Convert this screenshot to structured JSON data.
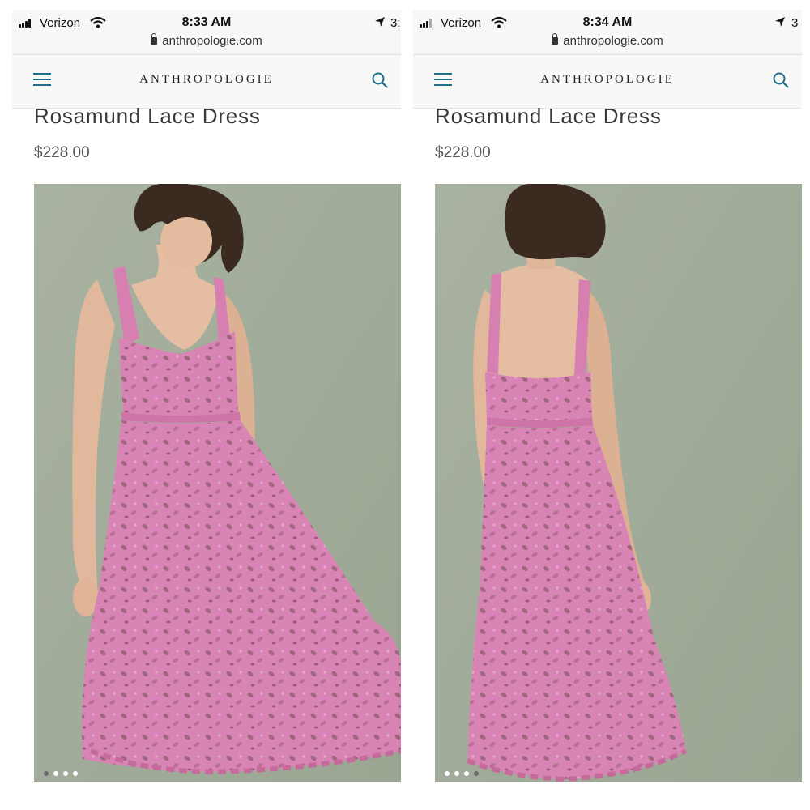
{
  "screens": [
    {
      "status": {
        "carrier": "Verizon",
        "time": "8:33 AM",
        "url": "anthropologie.com",
        "battery_partial": "3:"
      },
      "header": {
        "brand": "ANTHROPOLOGIE"
      },
      "product": {
        "title": "Rosamund Lace Dress",
        "price": "$228.00",
        "image_view": "front"
      },
      "carousel": {
        "count": 4,
        "active_index": 0
      }
    },
    {
      "status": {
        "carrier": "Verizon",
        "time": "8:34 AM",
        "url": "anthropologie.com",
        "battery_partial": "3"
      },
      "header": {
        "brand": "ANTHROPOLOGIE"
      },
      "product": {
        "title": "Rosamund Lace Dress",
        "price": "$228.00",
        "image_view": "back"
      },
      "carousel": {
        "count": 4,
        "active_index": 3
      }
    }
  ],
  "colors": {
    "accent": "#1f6e8c",
    "photo_background": "#a3ad9c",
    "dress_pink": "#d885b5",
    "hair": "#3b2a20",
    "skin": "#e2b89c"
  },
  "icons": {
    "menu": "hamburger-menu-icon",
    "search": "search-icon",
    "lock": "lock-icon",
    "wifi": "wifi-icon",
    "location": "location-arrow-icon"
  }
}
